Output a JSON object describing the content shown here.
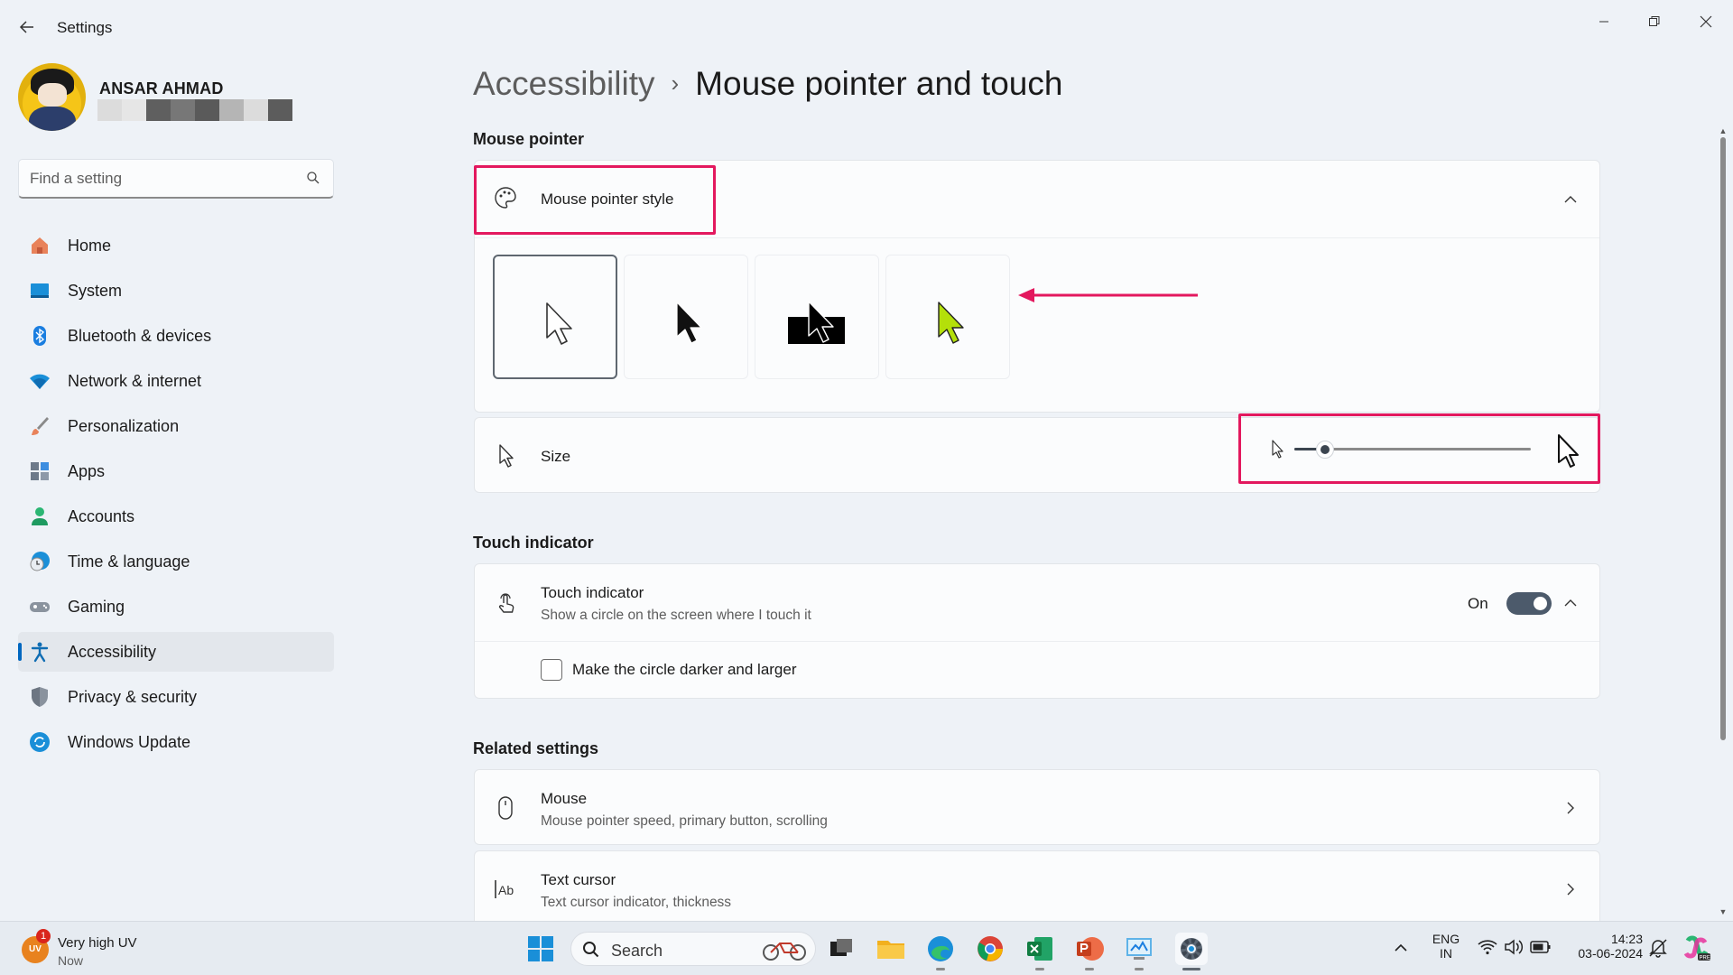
{
  "window": {
    "title": "Settings",
    "back_icon": "back-arrow-icon",
    "controls": [
      "minimize",
      "restore",
      "close"
    ]
  },
  "user": {
    "name": "ANSAR AHMAD",
    "email_redacted_colors": [
      "#dcdcdc",
      "#e6e6e6",
      "#5f5f5f",
      "#777777",
      "#5a5a5a",
      "#b5b5b5",
      "#dcdcdc",
      "#5c5c5c"
    ]
  },
  "search": {
    "placeholder": "Find a setting"
  },
  "sidebar": {
    "items": [
      {
        "label": "Home",
        "icon": "home-icon"
      },
      {
        "label": "System",
        "icon": "system-icon"
      },
      {
        "label": "Bluetooth & devices",
        "icon": "bluetooth-icon"
      },
      {
        "label": "Network & internet",
        "icon": "wifi-icon"
      },
      {
        "label": "Personalization",
        "icon": "brush-icon"
      },
      {
        "label": "Apps",
        "icon": "apps-icon"
      },
      {
        "label": "Accounts",
        "icon": "person-icon"
      },
      {
        "label": "Time & language",
        "icon": "clock-globe-icon"
      },
      {
        "label": "Gaming",
        "icon": "gamepad-icon"
      },
      {
        "label": "Accessibility",
        "icon": "accessibility-icon",
        "active": true
      },
      {
        "label": "Privacy & security",
        "icon": "shield-icon"
      },
      {
        "label": "Windows Update",
        "icon": "update-icon"
      }
    ]
  },
  "breadcrumb": {
    "parent": "Accessibility",
    "separator": "›",
    "current": "Mouse pointer and touch"
  },
  "mouse_pointer": {
    "section_title": "Mouse pointer",
    "style_label": "Mouse pointer style",
    "styles": [
      {
        "name": "white",
        "selected": true
      },
      {
        "name": "black",
        "selected": false
      },
      {
        "name": "inverted",
        "selected": false
      },
      {
        "name": "custom",
        "selected": false,
        "color": "#b4e00a"
      }
    ],
    "size_label": "Size",
    "size_value": 0.1
  },
  "touch": {
    "section_title": "Touch indicator",
    "title": "Touch indicator",
    "subtitle": "Show a circle on the screen where I touch it",
    "state_label": "On",
    "enabled": true,
    "option_label": "Make the circle darker and larger",
    "option_checked": false
  },
  "related": {
    "section_title": "Related settings",
    "items": [
      {
        "title": "Mouse",
        "subtitle": "Mouse pointer speed, primary button, scrolling",
        "icon": "mouse-icon"
      },
      {
        "title": "Text cursor",
        "subtitle": "Text cursor indicator, thickness",
        "icon": "text-cursor-icon"
      }
    ]
  },
  "annotations": {
    "highlight_color": "#e3185e"
  },
  "taskbar": {
    "weather": {
      "title": "Very high UV",
      "subtitle": "Now",
      "badge": "1",
      "icon_text": "UV"
    },
    "search_label": "Search",
    "lang": {
      "line1": "ENG",
      "line2": "IN"
    },
    "clock": {
      "time": "14:23",
      "date": "03-06-2024"
    }
  },
  "colors": {
    "accent": "#0067c0",
    "background": "#eef2f7",
    "card": "#fbfcfd"
  }
}
